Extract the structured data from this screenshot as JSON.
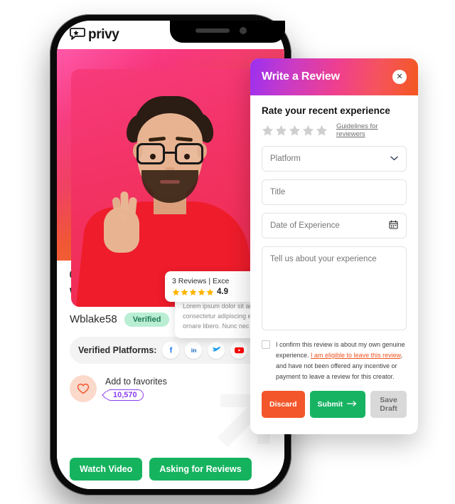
{
  "app": {
    "brand_name": "privy",
    "brand_logo_icon": "speech-bubble-star-icon",
    "grid_icon": "grid-dashboard-icon",
    "grid_icon_color": "#f4633a"
  },
  "profile": {
    "category_icon": "gamepad-icon",
    "category": "GAMING",
    "name": "William Blake",
    "handle": "Wblake58",
    "verified_badge": "Verified",
    "platforms_label": "Verified Platforms:",
    "platforms": [
      {
        "name": "facebook-icon",
        "glyph": "f",
        "color": "#1877f2"
      },
      {
        "name": "linkedin-icon",
        "glyph": "in",
        "color": "#0a66c2"
      },
      {
        "name": "twitter-icon",
        "glyph": "➤",
        "color": "#1d9bf0"
      },
      {
        "name": "youtube-icon",
        "glyph": "▶",
        "color": "#ff0000"
      }
    ],
    "favorites_label": "Add to favorites",
    "favorites_count": "10,570",
    "favorites_count_color": "#8c3ef0",
    "heart_icon": "heart-outline-icon"
  },
  "review_card": {
    "summary": "3 Reviews  |  Exce",
    "score": "4.9",
    "star_color": "#ffb400",
    "popover_text": "Lorem ipsum dolor sit am consectetur adipiscing elit. Nu ornare libero. Nunc nec mauri"
  },
  "cta": {
    "watch_video": "Watch Video",
    "asking_for_reviews": "Asking for Reviews",
    "color": "#16b35f"
  },
  "modal": {
    "title": "Write a Review",
    "close_icon": "close-icon",
    "rate_heading": "Rate your recent experience",
    "stars_total": 5,
    "stars_selected": 0,
    "guidelines_link": "Guidelines for reviewers",
    "fields": {
      "platform_placeholder": "Platform",
      "platform_icon": "chevron-down-icon",
      "title_placeholder": "Title",
      "date_placeholder": "Date of Experience",
      "date_icon": "calendar-icon",
      "experience_placeholder": "Tell us about your experience"
    },
    "consent": {
      "part1": "I confirm this review is about my own genuine experience. ",
      "link": "I am eligible to leave this review",
      "part2": ", and have not been offered any incentive or payment to leave a review for this creator.",
      "link_color": "#f0521f",
      "checked": false
    },
    "buttons": {
      "discard": "Discard",
      "submit": "Submit",
      "submit_icon": "arrow-right-icon",
      "save_draft": "Save Draft"
    },
    "header_gradient": [
      "#9b30f0",
      "#ef3f8e",
      "#f4571f"
    ]
  }
}
